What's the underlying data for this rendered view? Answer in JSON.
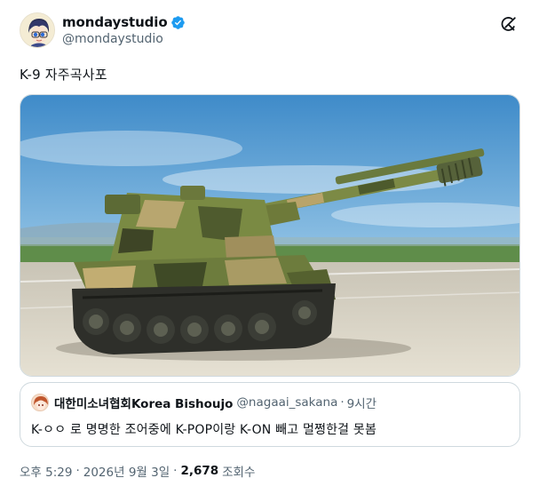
{
  "author": {
    "display_name": "mondaystudio",
    "handle": "@mondaystudio",
    "verified": true
  },
  "tweet": {
    "text": "K-9 자주곡사포"
  },
  "media": {
    "alt": "K9 self-propelled howitzer on a runway",
    "icon": "photo"
  },
  "quote": {
    "display_name": "대한미소녀협회Korea Bishoujo",
    "handle": "@nagaai_sakana",
    "separator": "·",
    "time": "9시간",
    "text": "K-ㅇㅇ 로 명명한 조어중에 K-POP이랑 K-ON 빼고 멀쩡한걸 못봄"
  },
  "meta": {
    "time": "오후 5:29",
    "separator": "·",
    "date": "2026년 9월 3일",
    "views_count": "2,678",
    "views_label": "조회수"
  },
  "colors": {
    "verified": "#1d9bf0",
    "secondary_text": "#536471",
    "border": "#cfd9de"
  }
}
